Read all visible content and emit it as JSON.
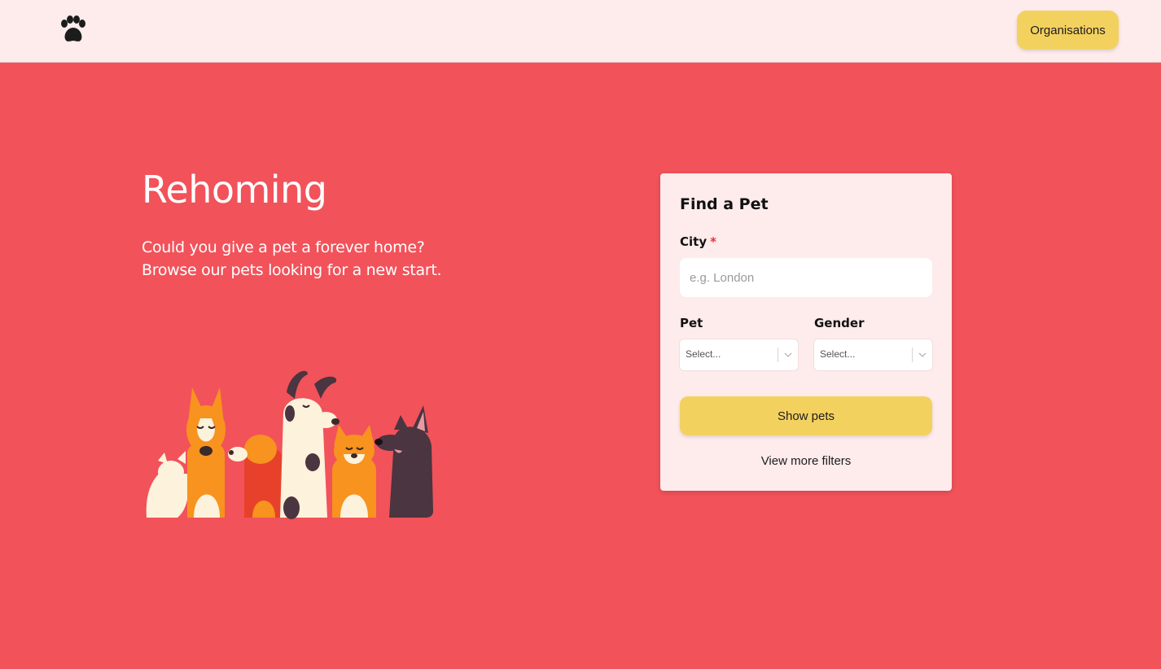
{
  "header": {
    "logo_icon": "paw-icon",
    "organisations_label": "Organisations"
  },
  "hero": {
    "title": "Rehoming",
    "subtitle_line1": "Could you give a pet a forever home?",
    "subtitle_line2": "Browse our pets looking for a new start.",
    "illustration": "dogs-illustration"
  },
  "search_card": {
    "title": "Find a Pet",
    "city": {
      "label": "City",
      "required_mark": "*",
      "placeholder": "e.g. London",
      "value": ""
    },
    "pet": {
      "label": "Pet",
      "placeholder": "Select..."
    },
    "gender": {
      "label": "Gender",
      "placeholder": "Select..."
    },
    "submit_label": "Show pets",
    "more_filters_label": "View more filters"
  },
  "colors": {
    "page_background": "#F2525A",
    "header_background": "#FEEBEC",
    "button_yellow": "#F3D15F",
    "required_red": "#E8323C"
  }
}
